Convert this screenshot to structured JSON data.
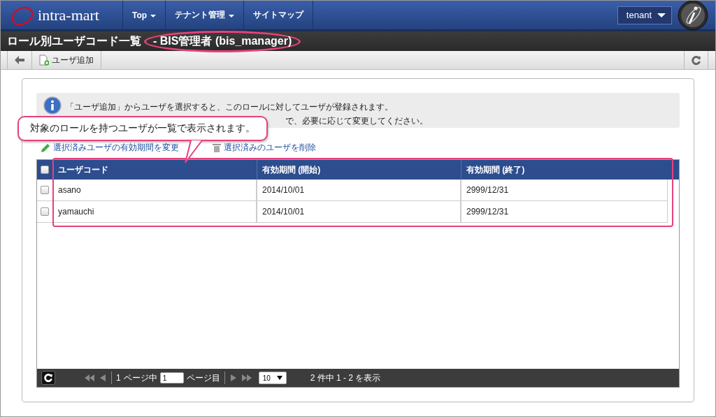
{
  "header": {
    "logo": "intra-mart",
    "nav": [
      {
        "label": "Top",
        "dropdown": true
      },
      {
        "label": "テナント管理",
        "dropdown": true
      },
      {
        "label": "サイトマップ",
        "dropdown": false
      }
    ],
    "tenant": "tenant"
  },
  "title": {
    "main": "ロール別ユーザコード一覧",
    "role": "- BIS管理者 (bis_manager)"
  },
  "toolbar": {
    "add": "ユーザ追加"
  },
  "info": [
    "「ユーザ追加」からユーザを選択すると、このロールに対してユーザが登録されます。",
    "で、必要に応じて変更してください。"
  ],
  "actions": [
    {
      "kind": "edit",
      "label": "選択済みユーザの有効期間を変更"
    },
    {
      "kind": "delete",
      "label": "選択済みのユーザを削除"
    }
  ],
  "table": {
    "select_all": {
      "checked": false
    },
    "columns": [
      "ユーザコード",
      "有効期間 (開始)",
      "有効期間 (終了)"
    ],
    "rows": [
      {
        "checked": false,
        "cells": [
          "asano",
          "2014/10/01",
          "2999/12/31"
        ]
      },
      {
        "checked": false,
        "cells": [
          "yamauchi",
          "2014/10/01",
          "2999/12/31"
        ]
      }
    ]
  },
  "pager": {
    "pages": "1",
    "of": "ページ中",
    "page": "1",
    "page_suffix": "ページ目",
    "size": "10",
    "summary": "2 件中 1 - 2 を表示"
  },
  "callout": "対象のロールを持つユーザが一覧で表示されます。"
}
